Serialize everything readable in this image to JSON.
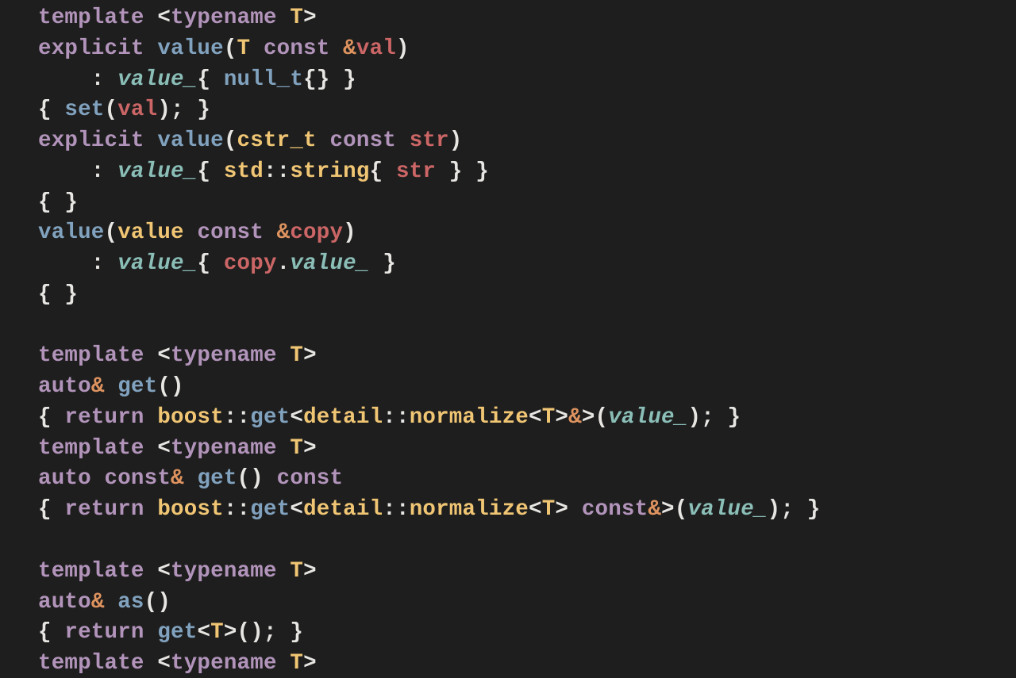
{
  "code": {
    "bg": "#1e1e1e",
    "colors": {
      "keyword": "#b294bb",
      "type": "#f0c674",
      "function": "#81a2be",
      "variable": "#cc6666",
      "member": "#8abeb7",
      "punct": "#e8e6e3",
      "amp": "#de935f"
    },
    "tokens": [
      [
        [
          "kw",
          "template"
        ],
        [
          "pun",
          " <"
        ],
        [
          "kw",
          "typename"
        ],
        [
          "pun",
          " "
        ],
        [
          "type",
          "T"
        ],
        [
          "pun",
          ">"
        ]
      ],
      [
        [
          "kw",
          "explicit"
        ],
        [
          "pun",
          " "
        ],
        [
          "fn",
          "value"
        ],
        [
          "pun",
          "("
        ],
        [
          "type",
          "T"
        ],
        [
          "pun",
          " "
        ],
        [
          "kw",
          "const"
        ],
        [
          "pun",
          " "
        ],
        [
          "amp",
          "&"
        ],
        [
          "var",
          "val"
        ],
        [
          "pun",
          ")"
        ]
      ],
      [
        [
          "pun",
          "    : "
        ],
        [
          "mem",
          "value_"
        ],
        [
          "pun",
          "{ "
        ],
        [
          "fn",
          "null_t"
        ],
        [
          "pun",
          "{} }"
        ]
      ],
      [
        [
          "pun",
          "{ "
        ],
        [
          "fn",
          "set"
        ],
        [
          "pun",
          "("
        ],
        [
          "var",
          "val"
        ],
        [
          "pun",
          "); }"
        ]
      ],
      [
        [
          "kw",
          "explicit"
        ],
        [
          "pun",
          " "
        ],
        [
          "fn",
          "value"
        ],
        [
          "pun",
          "("
        ],
        [
          "type",
          "cstr_t"
        ],
        [
          "pun",
          " "
        ],
        [
          "kw",
          "const"
        ],
        [
          "pun",
          " "
        ],
        [
          "var",
          "str"
        ],
        [
          "pun",
          ")"
        ]
      ],
      [
        [
          "pun",
          "    : "
        ],
        [
          "mem",
          "value_"
        ],
        [
          "pun",
          "{ "
        ],
        [
          "type",
          "std"
        ],
        [
          "pun",
          "::"
        ],
        [
          "type",
          "string"
        ],
        [
          "pun",
          "{ "
        ],
        [
          "var",
          "str"
        ],
        [
          "pun",
          " } }"
        ]
      ],
      [
        [
          "pun",
          "{ }"
        ]
      ],
      [
        [
          "fn",
          "value"
        ],
        [
          "pun",
          "("
        ],
        [
          "type",
          "value"
        ],
        [
          "pun",
          " "
        ],
        [
          "kw",
          "const"
        ],
        [
          "pun",
          " "
        ],
        [
          "amp",
          "&"
        ],
        [
          "var",
          "copy"
        ],
        [
          "pun",
          ")"
        ]
      ],
      [
        [
          "pun",
          "    : "
        ],
        [
          "mem",
          "value_"
        ],
        [
          "pun",
          "{ "
        ],
        [
          "var",
          "copy"
        ],
        [
          "pun",
          "."
        ],
        [
          "mem",
          "value_"
        ],
        [
          "pun",
          " }"
        ]
      ],
      [
        [
          "pun",
          "{ }"
        ]
      ],
      [
        [
          "pun",
          ""
        ]
      ],
      [
        [
          "kw",
          "template"
        ],
        [
          "pun",
          " <"
        ],
        [
          "kw",
          "typename"
        ],
        [
          "pun",
          " "
        ],
        [
          "type",
          "T"
        ],
        [
          "pun",
          ">"
        ]
      ],
      [
        [
          "kw",
          "auto"
        ],
        [
          "amp",
          "&"
        ],
        [
          "pun",
          " "
        ],
        [
          "fn",
          "get"
        ],
        [
          "pun",
          "()"
        ]
      ],
      [
        [
          "pun",
          "{ "
        ],
        [
          "kw",
          "return"
        ],
        [
          "pun",
          " "
        ],
        [
          "type",
          "boost"
        ],
        [
          "pun",
          "::"
        ],
        [
          "fn",
          "get"
        ],
        [
          "pun",
          "<"
        ],
        [
          "type",
          "detail"
        ],
        [
          "pun",
          "::"
        ],
        [
          "type",
          "normalize"
        ],
        [
          "pun",
          "<"
        ],
        [
          "type",
          "T"
        ],
        [
          "pun",
          ">"
        ],
        [
          "amp",
          "&"
        ],
        [
          "pun",
          ">("
        ],
        [
          "mem",
          "value_"
        ],
        [
          "pun",
          "); }"
        ]
      ],
      [
        [
          "kw",
          "template"
        ],
        [
          "pun",
          " <"
        ],
        [
          "kw",
          "typename"
        ],
        [
          "pun",
          " "
        ],
        [
          "type",
          "T"
        ],
        [
          "pun",
          ">"
        ]
      ],
      [
        [
          "kw",
          "auto"
        ],
        [
          "pun",
          " "
        ],
        [
          "kw",
          "const"
        ],
        [
          "amp",
          "&"
        ],
        [
          "pun",
          " "
        ],
        [
          "fn",
          "get"
        ],
        [
          "pun",
          "() "
        ],
        [
          "kw",
          "const"
        ]
      ],
      [
        [
          "pun",
          "{ "
        ],
        [
          "kw",
          "return"
        ],
        [
          "pun",
          " "
        ],
        [
          "type",
          "boost"
        ],
        [
          "pun",
          "::"
        ],
        [
          "fn",
          "get"
        ],
        [
          "pun",
          "<"
        ],
        [
          "type",
          "detail"
        ],
        [
          "pun",
          "::"
        ],
        [
          "type",
          "normalize"
        ],
        [
          "pun",
          "<"
        ],
        [
          "type",
          "T"
        ],
        [
          "pun",
          "> "
        ],
        [
          "kw",
          "const"
        ],
        [
          "amp",
          "&"
        ],
        [
          "pun",
          ">("
        ],
        [
          "mem",
          "value_"
        ],
        [
          "pun",
          "); }"
        ]
      ],
      [
        [
          "pun",
          ""
        ]
      ],
      [
        [
          "kw",
          "template"
        ],
        [
          "pun",
          " <"
        ],
        [
          "kw",
          "typename"
        ],
        [
          "pun",
          " "
        ],
        [
          "type",
          "T"
        ],
        [
          "pun",
          ">"
        ]
      ],
      [
        [
          "kw",
          "auto"
        ],
        [
          "amp",
          "&"
        ],
        [
          "pun",
          " "
        ],
        [
          "fn",
          "as"
        ],
        [
          "pun",
          "()"
        ]
      ],
      [
        [
          "pun",
          "{ "
        ],
        [
          "kw",
          "return"
        ],
        [
          "pun",
          " "
        ],
        [
          "fn",
          "get"
        ],
        [
          "pun",
          "<"
        ],
        [
          "type",
          "T"
        ],
        [
          "pun",
          ">(); }"
        ]
      ],
      [
        [
          "kw",
          "template"
        ],
        [
          "pun",
          " <"
        ],
        [
          "kw",
          "typename"
        ],
        [
          "pun",
          " "
        ],
        [
          "type",
          "T"
        ],
        [
          "pun",
          ">"
        ]
      ]
    ]
  }
}
